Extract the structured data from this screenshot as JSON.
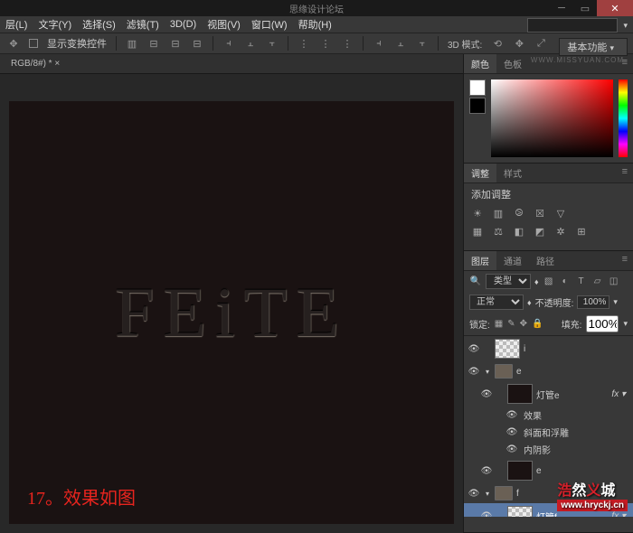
{
  "title_watermark": "思缘设计论坛",
  "url_watermark": "WWW.MISSYUAN.COM",
  "menu": [
    "层(L)",
    "文字(Y)",
    "选择(S)",
    "滤镜(T)",
    "3D(D)",
    "视图(V)",
    "窗口(W)",
    "帮助(H)"
  ],
  "options": {
    "transform_label": "显示变换控件",
    "mode_label": "3D 模式:"
  },
  "workspace": "基本功能",
  "doc_tab": "RGB/8#) * ×",
  "canvas_text": "FEiTE",
  "caption": "17。效果如图",
  "panel_color": {
    "tab1": "颜色",
    "tab2": "色板"
  },
  "panel_adjust": {
    "tab1": "调整",
    "tab2": "样式",
    "label": "添加调整"
  },
  "panel_layers": {
    "tab1": "图层",
    "tab2": "通道",
    "tab3": "路径",
    "filter": "类型",
    "blend": "正常",
    "opacity_label": "不透明度:",
    "opacity": "100%",
    "lock_label": "锁定:",
    "fill_label": "填充:",
    "fill": "100%",
    "items": [
      {
        "name": "i"
      },
      {
        "name": "e",
        "folder": true
      },
      {
        "name": "灯管e",
        "fx": true
      },
      {
        "fx_label": "效果"
      },
      {
        "fx_item1": "斜面和浮雕"
      },
      {
        "fx_item2": "内阴影"
      },
      {
        "name2": "e"
      },
      {
        "name": "f",
        "folder": true
      },
      {
        "name": "灯管f",
        "fx": true,
        "active": true
      }
    ]
  },
  "wm_brand": "浩然义城",
  "wm_url": "www.hryckj.cn"
}
